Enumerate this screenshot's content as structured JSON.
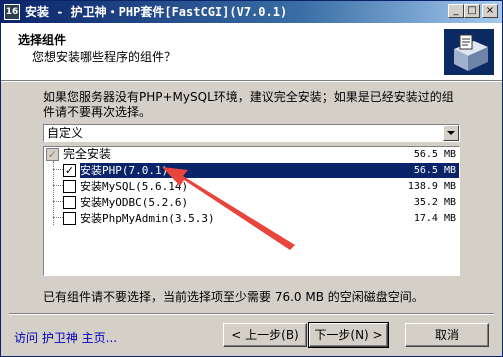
{
  "window": {
    "title": "安装 - 护卫神・PHP套件[FastCGI](V7.0.1)",
    "app_icon_text": "16",
    "minimize": "_",
    "maximize": "□",
    "close": "×"
  },
  "header": {
    "title": "选择组件",
    "subtitle": "您想安装哪些程序的组件？"
  },
  "description": "如果您服务器没有PHP+MySQL环境，建议完全安装；如果是已经安装过的组件请不要再次选择。",
  "type_select": {
    "value": "自定义"
  },
  "components": {
    "root": {
      "label": "完全安装",
      "size": "56.5 MB",
      "state": "indeterminate"
    },
    "items": [
      {
        "label": "安装PHP(7.0.1)",
        "size": "56.5 MB",
        "checked": true,
        "selected": true
      },
      {
        "label": "安装MySQL(5.6.14)",
        "size": "138.9 MB",
        "checked": false
      },
      {
        "label": "安装MyODBC(5.2.6)",
        "size": "35.2 MB",
        "checked": false
      },
      {
        "label": "安装PhpMyAdmin(3.5.3)",
        "size": "17.4 MB",
        "checked": false
      }
    ]
  },
  "space_text": "已有组件请不要选择，当前选择项至少需要 76.0 MB 的空闲磁盘空间。",
  "footer": {
    "link": "访问 护卫神 主页...",
    "back": "< 上一步(B)",
    "next": "下一步(N) >",
    "cancel": "取消"
  },
  "colors": {
    "annotation_arrow": "#e8453c",
    "selection": "#0a246a"
  }
}
